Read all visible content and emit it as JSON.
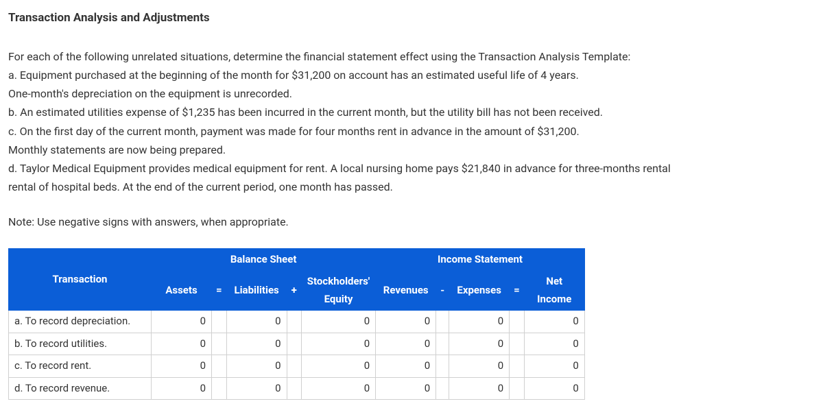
{
  "title": "Transaction Analysis and Adjustments",
  "intro": "For each of the following unrelated situations, determine the financial statement effect using the Transaction Analysis Template:",
  "items": {
    "a1": "a. Equipment purchased at the beginning of the month for $31,200 on account has an estimated useful life of 4 years.",
    "a2": "One-month's depreciation on the equipment is unrecorded.",
    "b": "b. An estimated utilities expense of $1,235 has been incurred in the current month, but the utility bill has not been received.",
    "c1": "c. On the first day of the current month, payment was made for four months rent in advance in the amount of $31,200.",
    "c2": "Monthly statements are now being prepared.",
    "d1": "d. Taylor Medical Equipment provides medical equipment for rent. A local nursing home pays $21,840 in advance for three-months rental",
    "d2": "rental of hospital beds. At the end of the current period, one month has passed."
  },
  "note": "Note: Use negative signs with answers, when appropriate.",
  "headers": {
    "balance_sheet": "Balance Sheet",
    "income_statement": "Income Statement",
    "transaction": "Transaction",
    "assets": "Assets",
    "liabilities": "Liabilities",
    "stockholders1": "Stockholders'",
    "equity": "Equity",
    "revenues": "Revenues",
    "expenses": "Expenses",
    "net_income": "Net Income",
    "eq": "=",
    "plus": "+",
    "minus": "-"
  },
  "rows": [
    {
      "label": "a. To record depreciation.",
      "assets": "0",
      "liabilities": "0",
      "equity": "0",
      "revenues": "0",
      "expenses": "0",
      "net_income": "0"
    },
    {
      "label": "b. To record utilities.",
      "assets": "0",
      "liabilities": "0",
      "equity": "0",
      "revenues": "0",
      "expenses": "0",
      "net_income": "0"
    },
    {
      "label": "c. To record rent.",
      "assets": "0",
      "liabilities": "0",
      "equity": "0",
      "revenues": "0",
      "expenses": "0",
      "net_income": "0"
    },
    {
      "label": "d. To record revenue.",
      "assets": "0",
      "liabilities": "0",
      "equity": "0",
      "revenues": "0",
      "expenses": "0",
      "net_income": "0"
    }
  ]
}
